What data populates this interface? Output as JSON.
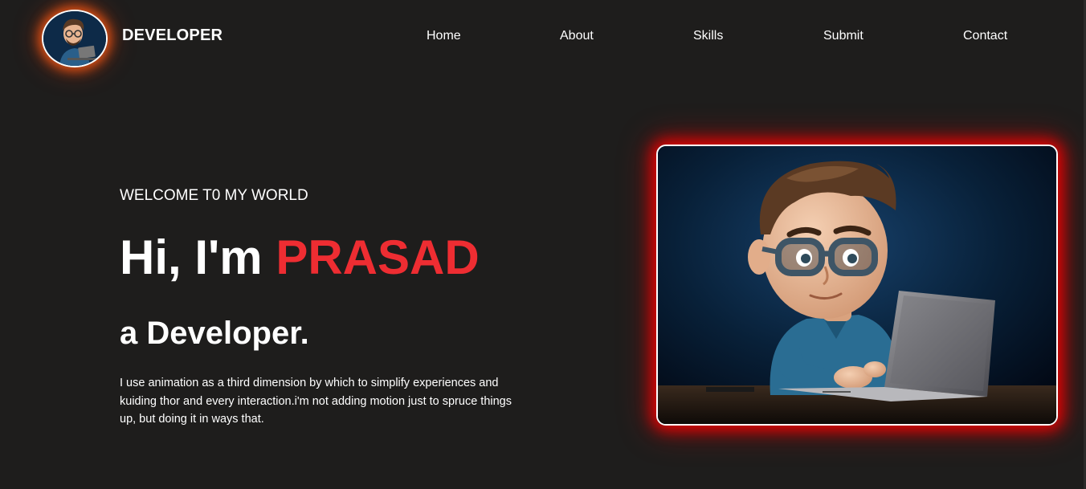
{
  "header": {
    "brand": "DEVELOPER",
    "logo_icon": "developer-avatar-icon",
    "nav": [
      "Home",
      "About",
      "Skills",
      "Submit",
      "Contact"
    ]
  },
  "hero": {
    "welcome": "WELCOME T0 MY WORLD",
    "greeting": "Hi, I'm",
    "name": "PRASAD",
    "role": "a Developer.",
    "description": "I use animation as a third dimension by which to simplify experiences and kuiding thor and every interaction.i'm not adding motion just to spruce things up, but doing it in ways that.",
    "image_icon": "developer-with-laptop-illustration"
  },
  "colors": {
    "background": "#1e1d1c",
    "accent": "#ee2d32",
    "logo_glow": "#ff5a14",
    "image_glow": "#ff0000"
  }
}
